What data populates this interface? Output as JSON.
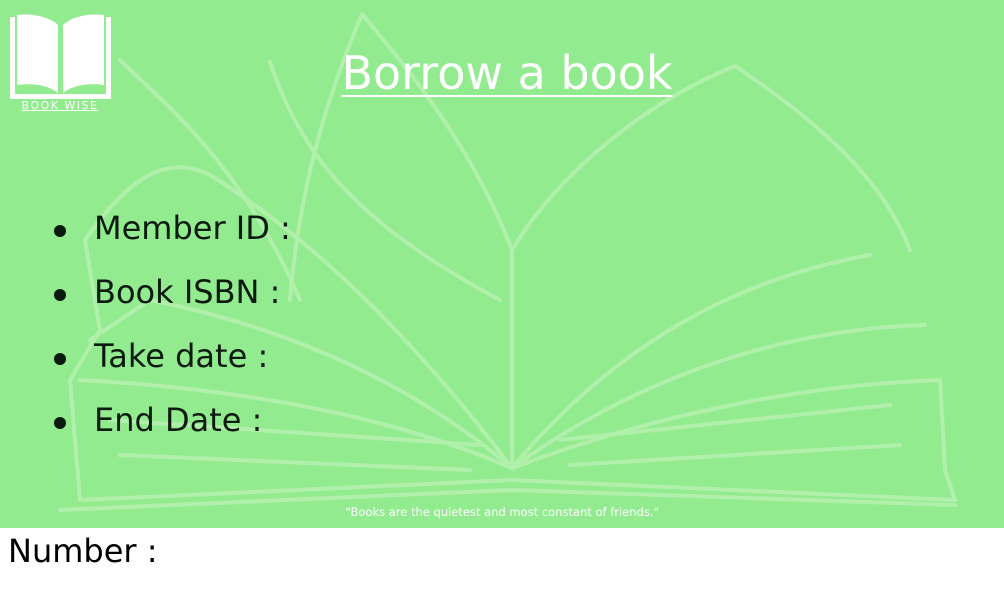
{
  "logo": {
    "label": "BOOK WISE",
    "icon": "open-book-icon"
  },
  "title": "Borrow a book",
  "fields": [
    {
      "label": "Member ID :"
    },
    {
      "label": "Book ISBN :"
    },
    {
      "label": "Take date :"
    },
    {
      "label": "End Date :"
    }
  ],
  "quote": "\"Books are the quietest and most constant of friends.\"",
  "footer": {
    "number_label": "Number :"
  },
  "colors": {
    "panel": "#92eb8f",
    "text": "#0d1a10",
    "accent": "#ffffff"
  }
}
